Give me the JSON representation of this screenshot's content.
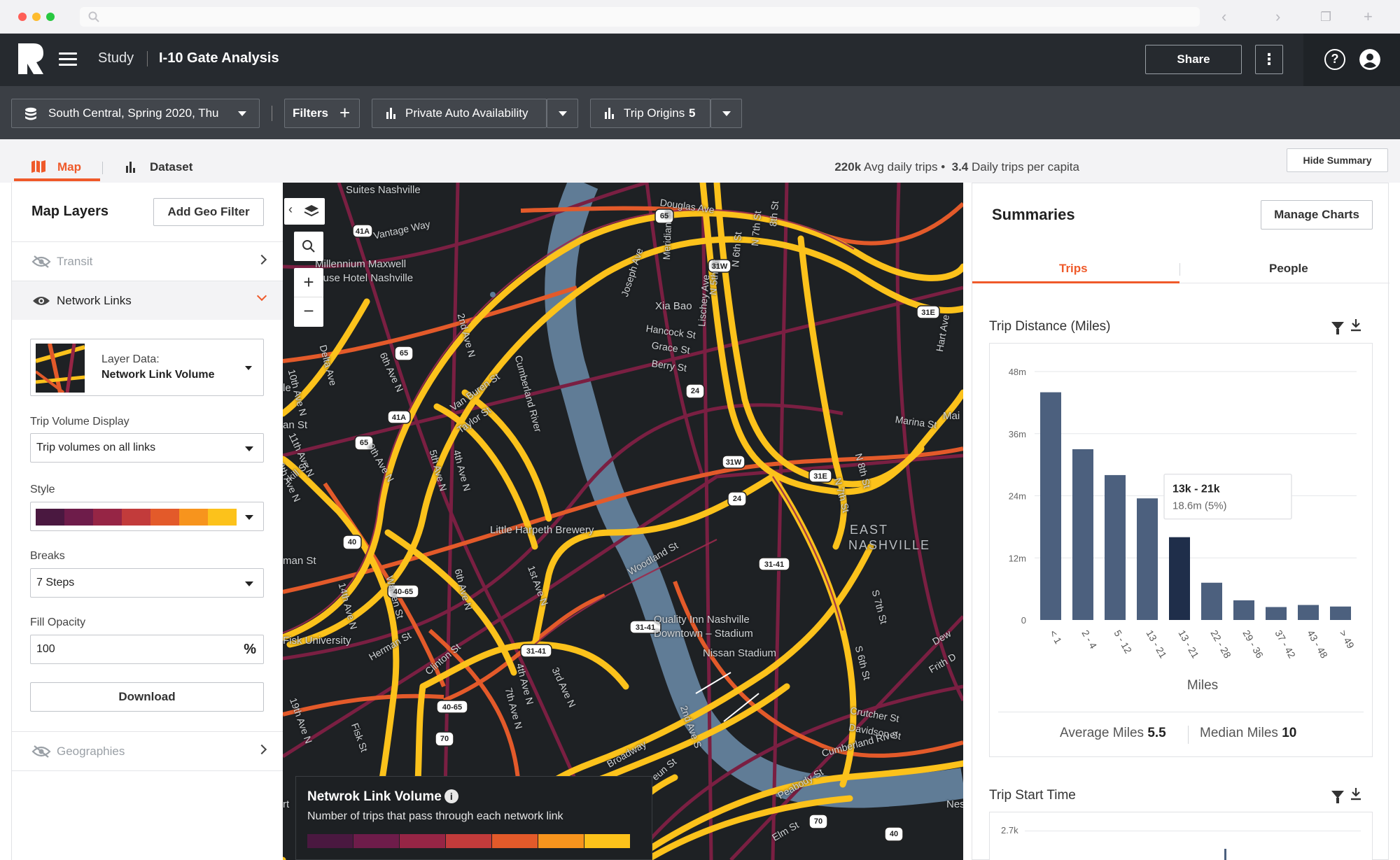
{
  "header": {
    "breadcrumb_study": "Study",
    "study_title": "I-10 Gate Analysis",
    "share_label": "Share"
  },
  "toolbar": {
    "dataset_label": "South Central, Spring 2020, Thu",
    "filters_label": "Filters",
    "metric_label": "Private Auto Availability",
    "trip_origins_label": "Trip Origins",
    "trip_origins_count": "5"
  },
  "view_tabs": {
    "map": "Map",
    "dataset": "Dataset"
  },
  "summary_bar": {
    "avg_daily_trips_value": "220k",
    "avg_daily_trips_label": "Avg daily trips •",
    "daily_trips_per_capita_value": "3.4",
    "daily_trips_per_capita_label": "Daily trips per capita",
    "hide_summary_label": "Hide Summary"
  },
  "map_layers": {
    "title": "Map Layers",
    "add_geo_filter_label": "Add Geo Filter",
    "transit_label": "Transit",
    "network_links_label": "Network Links",
    "layer_data_caption": "Layer Data:",
    "layer_data_value": "Network Link Volume",
    "trip_volume_display_label": "Trip Volume Display",
    "trip_volume_display_value": "Trip volumes on all links",
    "style_label": "Style",
    "style_ramp": [
      "#4a1840",
      "#6e1c4a",
      "#962545",
      "#c23b3b",
      "#e35a2a",
      "#f7941d",
      "#fcc21b"
    ],
    "breaks_label": "Breaks",
    "breaks_value": "7 Steps",
    "fill_opacity_label": "Fill Opacity",
    "fill_opacity_value": "100",
    "fill_opacity_unit": "%",
    "download_label": "Download",
    "geographies_label": "Geographies"
  },
  "map": {
    "legend_title": "Netwrok Link Volume",
    "legend_subtitle": "Number of trips that pass through each network link",
    "place_labels": [
      "Suites Nashville",
      "Douglas Ave",
      "Vantage Way",
      "Millennium Maxwell",
      "louse Hotel Nashville",
      "Meridian St",
      "Joseph Ave",
      "Xia Bao",
      "Hancock St",
      "Grace St",
      "Berry St",
      "Lischey Ave",
      "N 5th St",
      "N 6th St",
      "N 7th St",
      "8th St",
      "Hart Ave",
      "Marina St",
      "Delta Ave",
      "10th Ave N",
      "6th Ave N",
      "2nd Ave N",
      "Van Buren St",
      "Taylor St",
      "5th Ave N",
      "4th Ave N",
      "9th Ave N",
      "11th Ave N",
      "12th Ave N",
      "Cumberland River",
      "Little Harpeth Brewery",
      "EAST",
      "NASHVILLE",
      "N 8th St",
      "N 7th St",
      "Mai",
      "an St",
      "le",
      "rkill St",
      "man St",
      "6th Ave N",
      "1st Ave N",
      "Warren St",
      "14th Ave N",
      "Woodland St",
      "Quality Inn Nashville",
      "Downtown – Stadium",
      "Nissan Stadium",
      "S 7th St",
      "S 6th St",
      "Dew",
      "Frith D",
      "Fisk University",
      "Herman St",
      "Clinton St",
      "19th Ave N",
      "Fisk St",
      "4th Ave N",
      "7th Ave N",
      "3rd Ave N",
      "2nd Ave S",
      "Crutcher St",
      "Davidson St",
      "Broadway",
      "Cumberland River",
      "Peabody St",
      "Elm St",
      "Nes",
      "eun St",
      "rt"
    ],
    "route_shields": [
      "41A",
      "65",
      "31W",
      "31E",
      "65",
      "24",
      "41A",
      "65",
      "31W",
      "31E",
      "24",
      "40",
      "40-65",
      "31-41",
      "31-41",
      "31-41",
      "40-65",
      "70",
      "70",
      "40"
    ]
  },
  "summaries": {
    "title": "Summaries",
    "manage_charts_label": "Manage Charts",
    "tabs": [
      "Trips",
      "People"
    ],
    "trip_distance_title": "Trip Distance (Miles)",
    "trip_start_time_title": "Trip Start Time",
    "average_miles_label": "Average Miles",
    "average_miles_value": "5.5",
    "median_miles_label": "Median Miles",
    "median_miles_value": "10",
    "tooltip_title": "13k - 21k",
    "tooltip_value": "18.6m (5%)",
    "start_time_tick": "2.7k"
  },
  "chart_data": {
    "type": "bar",
    "title": "Trip Distance (Miles)",
    "xlabel": "Miles",
    "ylabel": "",
    "categories": [
      "< 1",
      "2 - 4",
      "5 - 12",
      "13 - 21",
      "13 - 21",
      "22 - 28",
      "29 - 36",
      "37 - 42",
      "43 - 48",
      "> 49"
    ],
    "values": [
      44,
      33,
      28,
      23.5,
      16,
      7.2,
      3.8,
      2.5,
      2.9,
      2.6
    ],
    "y_ticks": [
      "0",
      "12m",
      "24m",
      "36m",
      "48m"
    ],
    "ylim": [
      0,
      48
    ],
    "grid": true,
    "highlight_index": 4,
    "bar_color": "#4c607e",
    "highlight_color": "#1f2e4a"
  },
  "colors": {
    "accent": "#ef5a2a",
    "header_bg": "#262a2f",
    "toolbar_bg": "#3b3f45",
    "map_bg": "#1e2124",
    "road_major": "#fcc21b",
    "road_mid": "#e35a2a",
    "road_minor": "#8e2449",
    "river": "#607c96"
  },
  "icons": [
    "search-icon",
    "zoom-in-icon",
    "zoom-out-icon",
    "layers-icon",
    "collapse-chevron-icon",
    "eye-icon",
    "eye-off-icon",
    "chevron-right-icon",
    "chevron-down-icon",
    "filter-icon",
    "download-icon",
    "info-icon",
    "help-icon",
    "user-avatar-icon",
    "map-icon",
    "bar-chart-icon",
    "database-icon",
    "plus-icon",
    "kebab-menu-icon"
  ]
}
